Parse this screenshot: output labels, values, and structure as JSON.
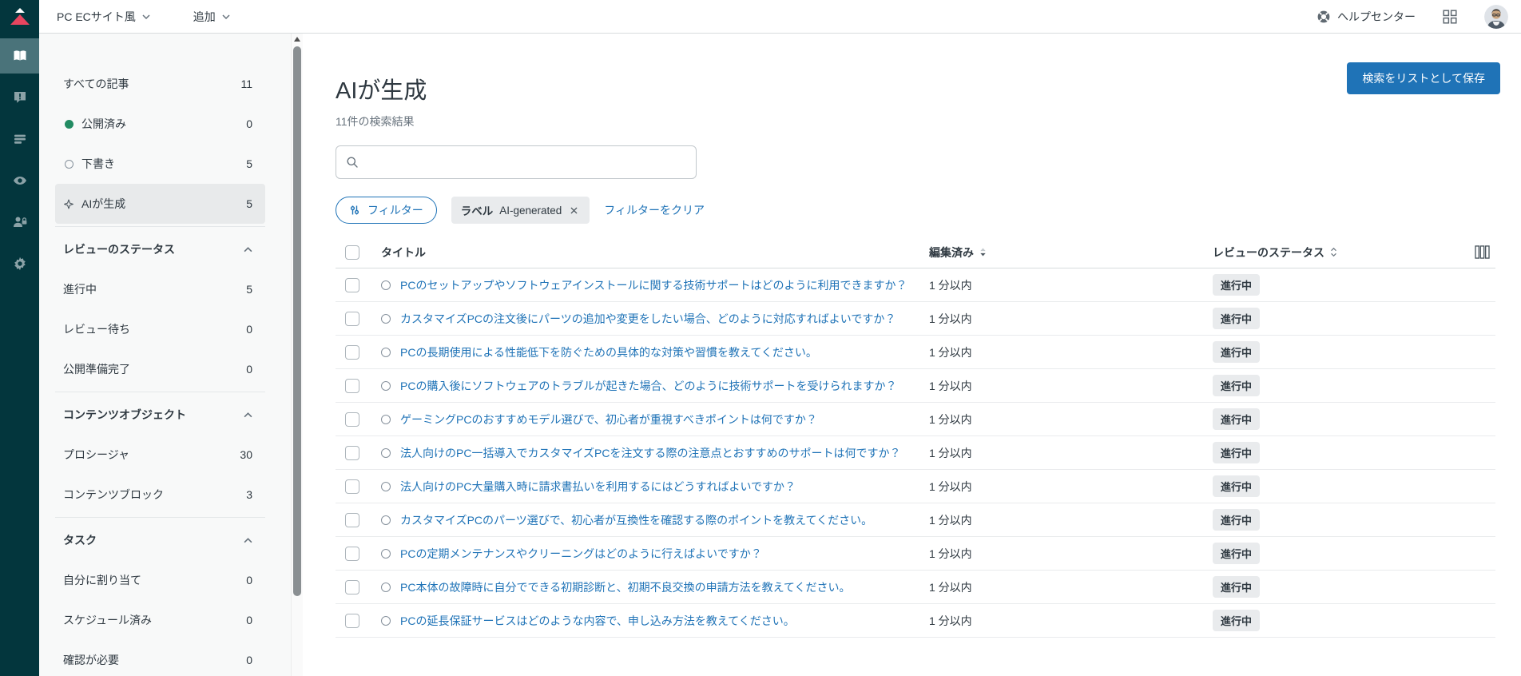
{
  "topbar": {
    "brand_label": "PC ECサイト風",
    "add_label": "追加",
    "help_label": "ヘルプセンター"
  },
  "sidebar": {
    "top_items": [
      {
        "label": "すべての記事",
        "count": "11",
        "icon": "none",
        "selected": false
      },
      {
        "label": "公開済み",
        "count": "0",
        "icon": "green-dot",
        "selected": false
      },
      {
        "label": "下書き",
        "count": "5",
        "icon": "hollow-circle",
        "selected": false
      },
      {
        "label": "AIが生成",
        "count": "5",
        "icon": "sparkle",
        "selected": true
      }
    ],
    "sections": [
      {
        "title": "レビューのステータス",
        "items": [
          {
            "label": "進行中",
            "count": "5"
          },
          {
            "label": "レビュー待ち",
            "count": "0"
          },
          {
            "label": "公開準備完了",
            "count": "0"
          }
        ]
      },
      {
        "title": "コンテンツオブジェクト",
        "items": [
          {
            "label": "プロシージャ",
            "count": "30"
          },
          {
            "label": "コンテンツブロック",
            "count": "3"
          }
        ]
      },
      {
        "title": "タスク",
        "items": [
          {
            "label": "自分に割り当て",
            "count": "0"
          },
          {
            "label": "スケジュール済み",
            "count": "0"
          },
          {
            "label": "確認が必要",
            "count": "0"
          }
        ]
      }
    ]
  },
  "main": {
    "title": "AIが生成",
    "result_count": "11件の検索結果",
    "save_list_button": "検索をリストとして保存",
    "search": {
      "placeholder": "",
      "value": ""
    },
    "filters": {
      "filter_button": "フィルター",
      "chip_label": "ラベル",
      "chip_value": "AI-generated",
      "clear_link": "フィルターをクリア"
    },
    "table": {
      "headers": {
        "title": "タイトル",
        "edited": "編集済み",
        "review_status": "レビューのステータス"
      },
      "rows": [
        {
          "title": "PCのセットアップやソフトウェアインストールに関する技術サポートはどのように利用できますか？",
          "edited": "1 分以内",
          "status": "進行中"
        },
        {
          "title": "カスタマイズPCの注文後にパーツの追加や変更をしたい場合、どのように対応すればよいですか？",
          "edited": "1 分以内",
          "status": "進行中"
        },
        {
          "title": "PCの長期使用による性能低下を防ぐための具体的な対策や習慣を教えてください。",
          "edited": "1 分以内",
          "status": "進行中"
        },
        {
          "title": "PCの購入後にソフトウェアのトラブルが起きた場合、どのように技術サポートを受けられますか？",
          "edited": "1 分以内",
          "status": "進行中"
        },
        {
          "title": "ゲーミングPCのおすすめモデル選びで、初心者が重視すべきポイントは何ですか？",
          "edited": "1 分以内",
          "status": "進行中"
        },
        {
          "title": "法人向けのPC一括導入でカスタマイズPCを注文する際の注意点とおすすめのサポートは何ですか？",
          "edited": "1 分以内",
          "status": "進行中"
        },
        {
          "title": "法人向けのPC大量購入時に請求書払いを利用するにはどうすればよいですか？",
          "edited": "1 分以内",
          "status": "進行中"
        },
        {
          "title": "カスタマイズPCのパーツ選びで、初心者が互換性を確認する際のポイントを教えてください。",
          "edited": "1 分以内",
          "status": "進行中"
        },
        {
          "title": "PCの定期メンテナンスやクリーニングはどのように行えばよいですか？",
          "edited": "1 分以内",
          "status": "進行中"
        },
        {
          "title": "PC本体の故障時に自分でできる初期診断と、初期不良交換の申請方法を教えてください。",
          "edited": "1 分以内",
          "status": "進行中"
        },
        {
          "title": "PCの延長保証サービスはどのような内容で、申し込み方法を教えてください。",
          "edited": "1 分以内",
          "status": "進行中"
        }
      ]
    }
  },
  "colors": {
    "accent_blue": "#1f73b7",
    "rail_bg": "#03363d",
    "rail_active": "#4a737a",
    "logo_red": "#e8455f",
    "status_green": "#228b62",
    "chip_bg": "#e9ebed"
  }
}
